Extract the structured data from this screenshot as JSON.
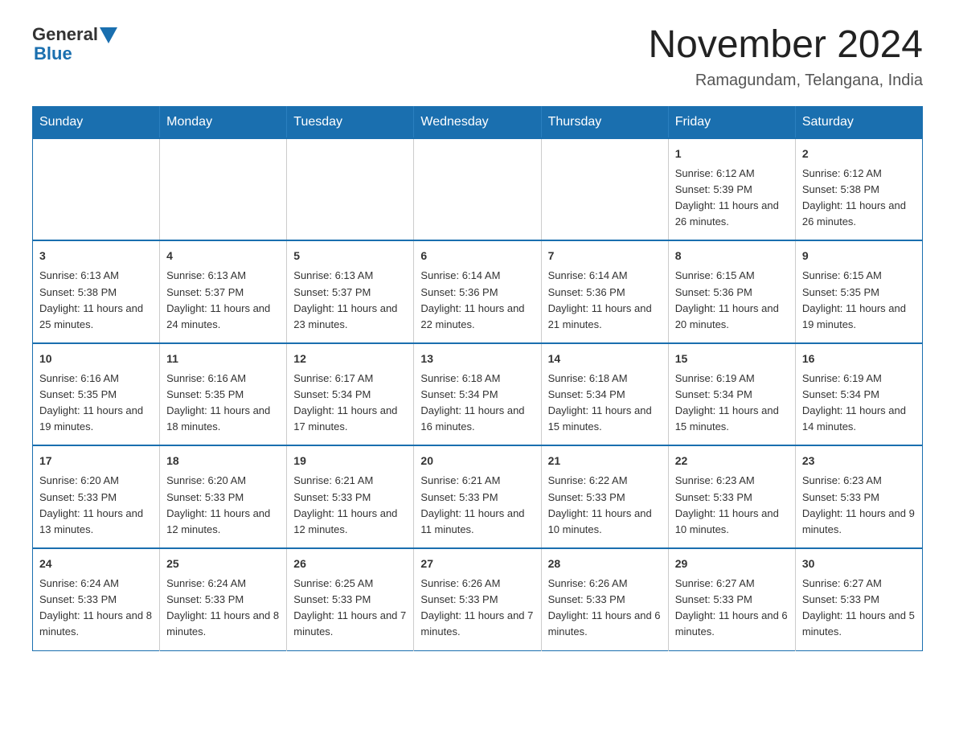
{
  "header": {
    "logo_general": "General",
    "logo_blue": "Blue",
    "main_title": "November 2024",
    "subtitle": "Ramagundam, Telangana, India"
  },
  "calendar": {
    "days_of_week": [
      "Sunday",
      "Monday",
      "Tuesday",
      "Wednesday",
      "Thursday",
      "Friday",
      "Saturday"
    ],
    "weeks": [
      {
        "days": [
          {
            "number": "",
            "info": ""
          },
          {
            "number": "",
            "info": ""
          },
          {
            "number": "",
            "info": ""
          },
          {
            "number": "",
            "info": ""
          },
          {
            "number": "",
            "info": ""
          },
          {
            "number": "1",
            "info": "Sunrise: 6:12 AM\nSunset: 5:39 PM\nDaylight: 11 hours and 26 minutes."
          },
          {
            "number": "2",
            "info": "Sunrise: 6:12 AM\nSunset: 5:38 PM\nDaylight: 11 hours and 26 minutes."
          }
        ]
      },
      {
        "days": [
          {
            "number": "3",
            "info": "Sunrise: 6:13 AM\nSunset: 5:38 PM\nDaylight: 11 hours and 25 minutes."
          },
          {
            "number": "4",
            "info": "Sunrise: 6:13 AM\nSunset: 5:37 PM\nDaylight: 11 hours and 24 minutes."
          },
          {
            "number": "5",
            "info": "Sunrise: 6:13 AM\nSunset: 5:37 PM\nDaylight: 11 hours and 23 minutes."
          },
          {
            "number": "6",
            "info": "Sunrise: 6:14 AM\nSunset: 5:36 PM\nDaylight: 11 hours and 22 minutes."
          },
          {
            "number": "7",
            "info": "Sunrise: 6:14 AM\nSunset: 5:36 PM\nDaylight: 11 hours and 21 minutes."
          },
          {
            "number": "8",
            "info": "Sunrise: 6:15 AM\nSunset: 5:36 PM\nDaylight: 11 hours and 20 minutes."
          },
          {
            "number": "9",
            "info": "Sunrise: 6:15 AM\nSunset: 5:35 PM\nDaylight: 11 hours and 19 minutes."
          }
        ]
      },
      {
        "days": [
          {
            "number": "10",
            "info": "Sunrise: 6:16 AM\nSunset: 5:35 PM\nDaylight: 11 hours and 19 minutes."
          },
          {
            "number": "11",
            "info": "Sunrise: 6:16 AM\nSunset: 5:35 PM\nDaylight: 11 hours and 18 minutes."
          },
          {
            "number": "12",
            "info": "Sunrise: 6:17 AM\nSunset: 5:34 PM\nDaylight: 11 hours and 17 minutes."
          },
          {
            "number": "13",
            "info": "Sunrise: 6:18 AM\nSunset: 5:34 PM\nDaylight: 11 hours and 16 minutes."
          },
          {
            "number": "14",
            "info": "Sunrise: 6:18 AM\nSunset: 5:34 PM\nDaylight: 11 hours and 15 minutes."
          },
          {
            "number": "15",
            "info": "Sunrise: 6:19 AM\nSunset: 5:34 PM\nDaylight: 11 hours and 15 minutes."
          },
          {
            "number": "16",
            "info": "Sunrise: 6:19 AM\nSunset: 5:34 PM\nDaylight: 11 hours and 14 minutes."
          }
        ]
      },
      {
        "days": [
          {
            "number": "17",
            "info": "Sunrise: 6:20 AM\nSunset: 5:33 PM\nDaylight: 11 hours and 13 minutes."
          },
          {
            "number": "18",
            "info": "Sunrise: 6:20 AM\nSunset: 5:33 PM\nDaylight: 11 hours and 12 minutes."
          },
          {
            "number": "19",
            "info": "Sunrise: 6:21 AM\nSunset: 5:33 PM\nDaylight: 11 hours and 12 minutes."
          },
          {
            "number": "20",
            "info": "Sunrise: 6:21 AM\nSunset: 5:33 PM\nDaylight: 11 hours and 11 minutes."
          },
          {
            "number": "21",
            "info": "Sunrise: 6:22 AM\nSunset: 5:33 PM\nDaylight: 11 hours and 10 minutes."
          },
          {
            "number": "22",
            "info": "Sunrise: 6:23 AM\nSunset: 5:33 PM\nDaylight: 11 hours and 10 minutes."
          },
          {
            "number": "23",
            "info": "Sunrise: 6:23 AM\nSunset: 5:33 PM\nDaylight: 11 hours and 9 minutes."
          }
        ]
      },
      {
        "days": [
          {
            "number": "24",
            "info": "Sunrise: 6:24 AM\nSunset: 5:33 PM\nDaylight: 11 hours and 8 minutes."
          },
          {
            "number": "25",
            "info": "Sunrise: 6:24 AM\nSunset: 5:33 PM\nDaylight: 11 hours and 8 minutes."
          },
          {
            "number": "26",
            "info": "Sunrise: 6:25 AM\nSunset: 5:33 PM\nDaylight: 11 hours and 7 minutes."
          },
          {
            "number": "27",
            "info": "Sunrise: 6:26 AM\nSunset: 5:33 PM\nDaylight: 11 hours and 7 minutes."
          },
          {
            "number": "28",
            "info": "Sunrise: 6:26 AM\nSunset: 5:33 PM\nDaylight: 11 hours and 6 minutes."
          },
          {
            "number": "29",
            "info": "Sunrise: 6:27 AM\nSunset: 5:33 PM\nDaylight: 11 hours and 6 minutes."
          },
          {
            "number": "30",
            "info": "Sunrise: 6:27 AM\nSunset: 5:33 PM\nDaylight: 11 hours and 5 minutes."
          }
        ]
      }
    ]
  }
}
